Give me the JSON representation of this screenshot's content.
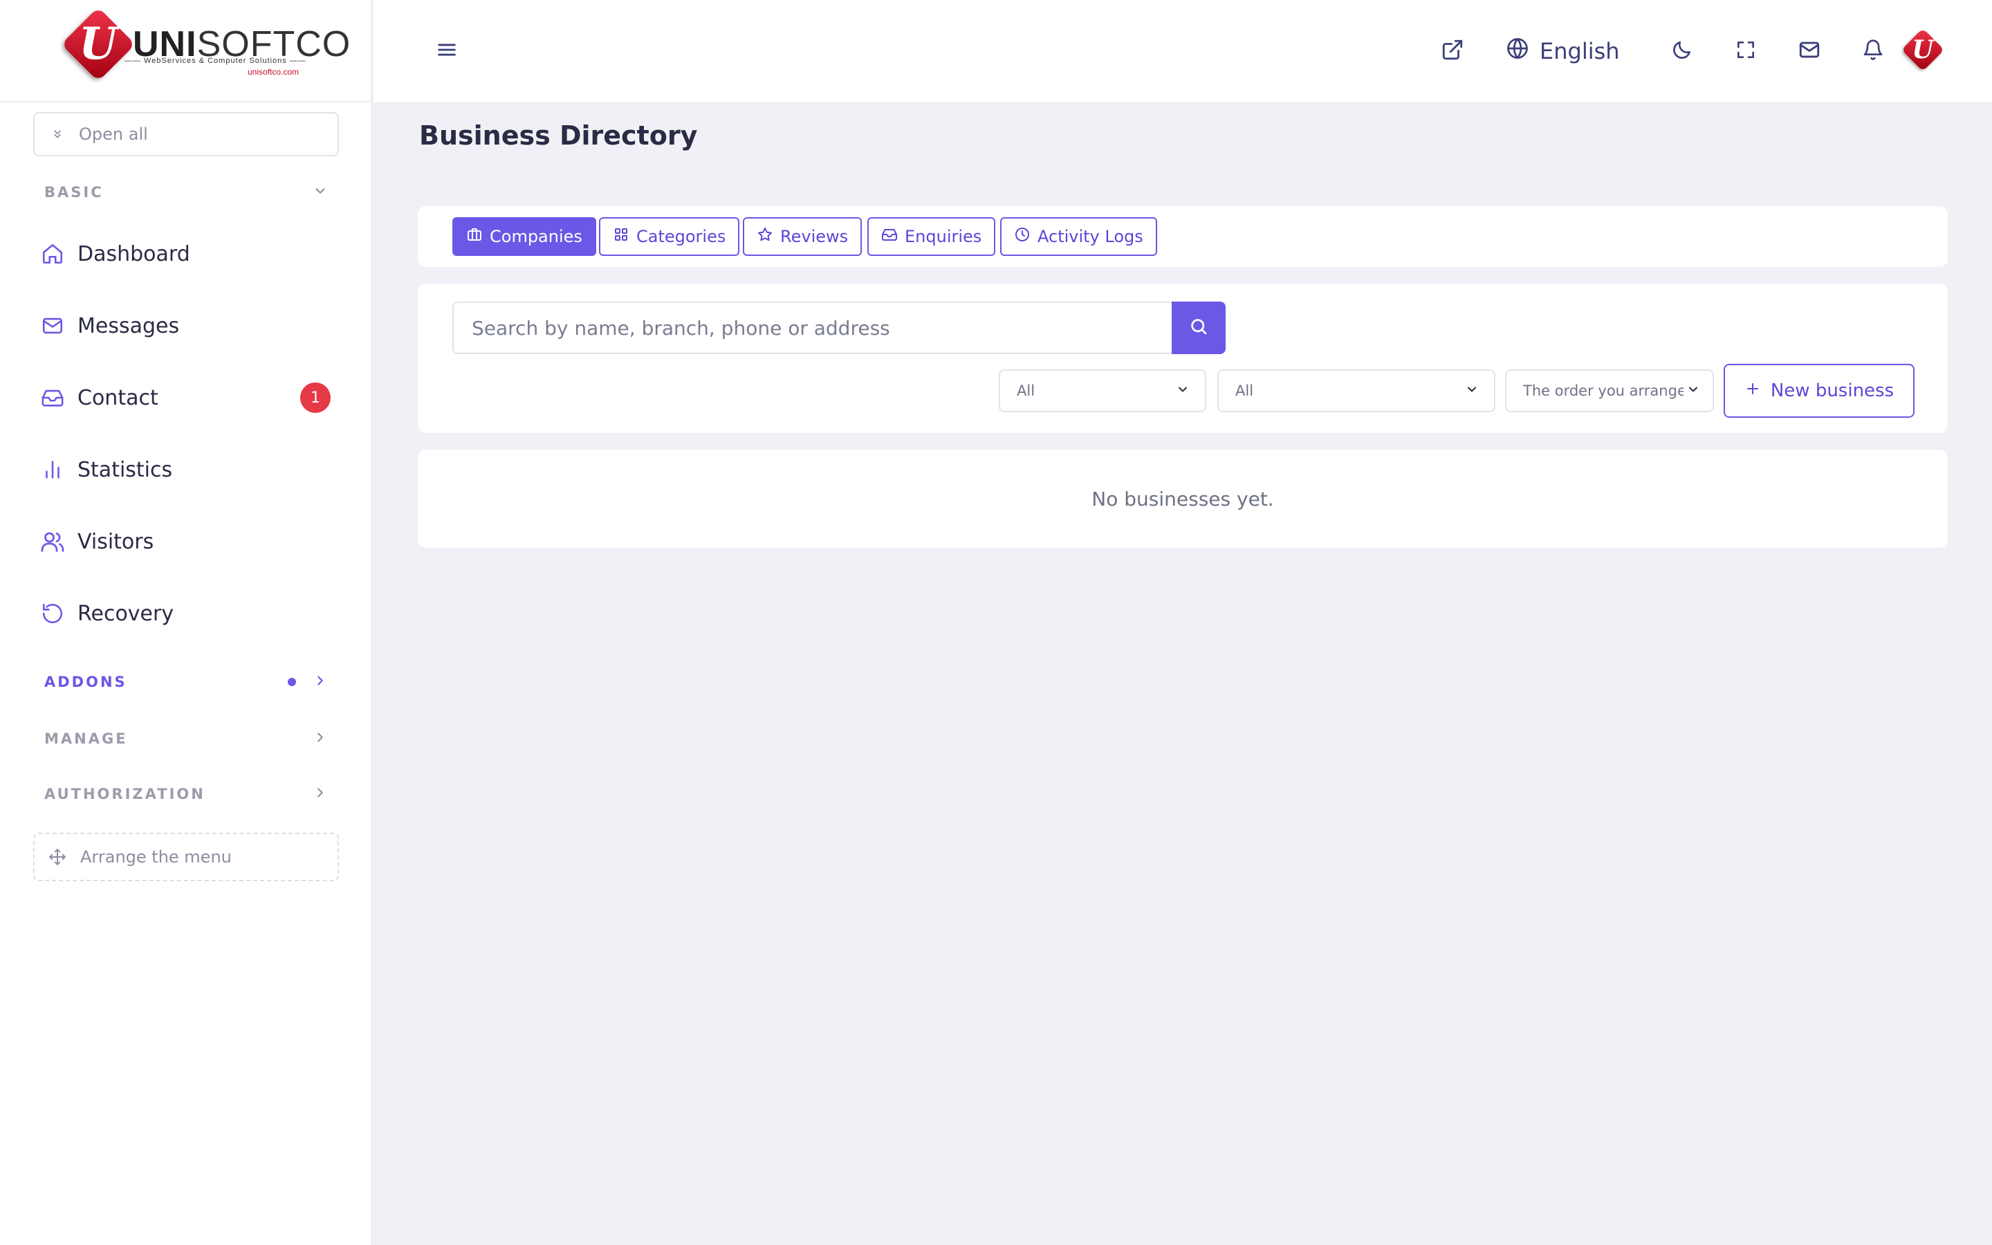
{
  "brand": {
    "name_bold": "UNI",
    "name_light": "SOFTCO",
    "tagline": "—— WebServices & Computer Solutions ——",
    "url": "unisoftco.com",
    "badge_letter": "U"
  },
  "sidebar": {
    "open_all_label": "Open all",
    "sections": [
      {
        "label": "BASIC",
        "expanded": true
      },
      {
        "label": "ADDONS",
        "expanded": false,
        "active": true
      },
      {
        "label": "MANAGE",
        "expanded": false
      },
      {
        "label": "AUTHORIZATION",
        "expanded": false
      }
    ],
    "items": [
      {
        "label": "Dashboard",
        "icon": "home-icon"
      },
      {
        "label": "Messages",
        "icon": "mail-icon"
      },
      {
        "label": "Contact",
        "icon": "inbox-icon",
        "badge": "1"
      },
      {
        "label": "Statistics",
        "icon": "bar-chart-icon"
      },
      {
        "label": "Visitors",
        "icon": "users-icon"
      },
      {
        "label": "Recovery",
        "icon": "history-icon"
      }
    ],
    "arrange_label": "Arrange the menu"
  },
  "topbar": {
    "language": "English",
    "avatar_letter": "U"
  },
  "page": {
    "title": "Business Directory"
  },
  "tabs": [
    {
      "label": "Companies",
      "icon": "briefcase-icon",
      "active": true
    },
    {
      "label": "Categories",
      "icon": "grid-icon",
      "active": false
    },
    {
      "label": "Reviews",
      "icon": "star-icon",
      "active": false
    },
    {
      "label": "Enquiries",
      "icon": "inbox-icon",
      "active": false
    },
    {
      "label": "Activity Logs",
      "icon": "clock-icon",
      "active": false
    }
  ],
  "search": {
    "placeholder": "Search by name, branch, phone or address",
    "value": ""
  },
  "filters": {
    "filter1": "All",
    "filter2": "All",
    "sort": "The order you arrangec"
  },
  "new_business_label": "New business",
  "empty_message": "No businesses yet.",
  "colors": {
    "accent": "#6b58e6",
    "badge": "#e63946",
    "background": "#f0f0f6"
  }
}
